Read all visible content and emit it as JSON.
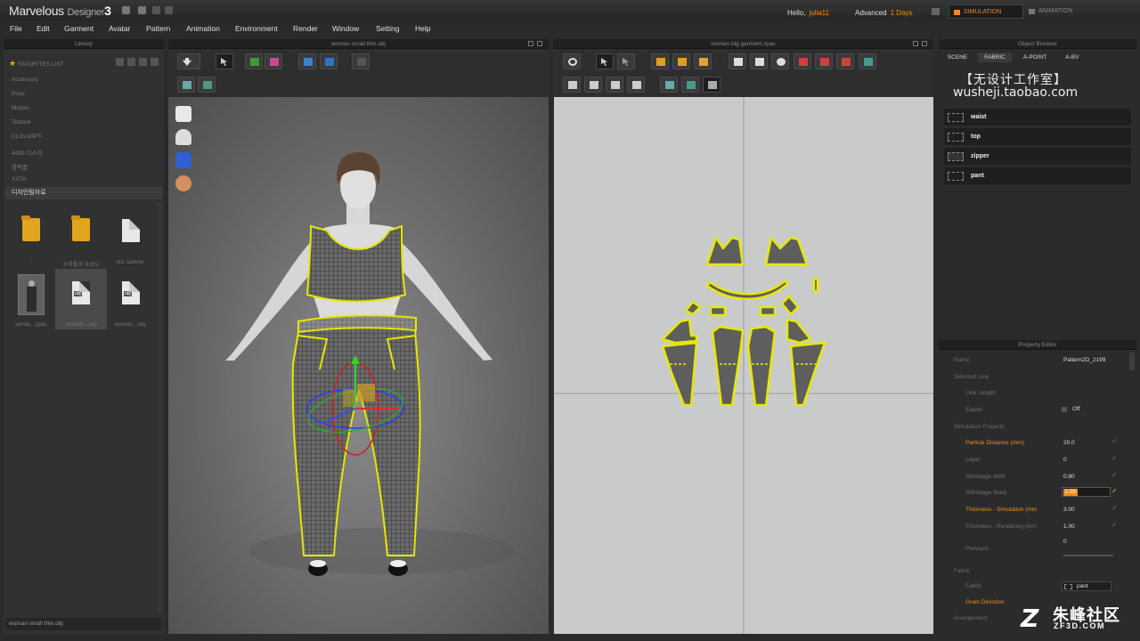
{
  "app": {
    "name": "Marvelous",
    "sub": "Designer",
    "version": "3",
    "greeting": "Hello,",
    "user": "julia11",
    "edition": "Advanced",
    "days": "1 Days",
    "modes": [
      "SIMULATION",
      "ANIMATION"
    ]
  },
  "menu": [
    "File",
    "Edit",
    "Garment",
    "Avatar",
    "Pattern",
    "Animation",
    "Environment",
    "Render",
    "Window",
    "Setting",
    "Help"
  ],
  "library": {
    "title": "Library",
    "favorites_label": "FAVORITES LIST",
    "items": [
      "Accessory",
      "Pose",
      "Motion",
      "Texture",
      "CLOvsOPTi",
      "4430-디스쳐",
      "참찍품",
      "XXTA"
    ],
    "selected": "디자인팀자료",
    "tiles": [
      {
        "type": "folder",
        "caption": ".."
      },
      {
        "type": "folder",
        "caption": "수학틀로 아셨다"
      },
      {
        "type": "doc",
        "caption": "001.camrec"
      },
      {
        "type": "thumb",
        "caption": "woma....zpac"
      },
      {
        "type": "obj",
        "caption": "woman....obj"
      },
      {
        "type": "obj",
        "caption": "woman....obj"
      }
    ],
    "obj_tag": "obj",
    "status": "woman small thin.obj"
  },
  "view3d": {
    "title": "woman small thin.obj"
  },
  "view2d": {
    "title": "woman big garment.zpac"
  },
  "object_browser": {
    "title": "Object Browser",
    "tabs": [
      "SCENE",
      "FABRIC",
      "A-POINT",
      "A-BV"
    ],
    "banner_line1": "【无设计工作室】",
    "banner_line2": "wusheji.taobao.com",
    "fabrics": [
      "waist",
      "top",
      "zipper",
      "pant"
    ]
  },
  "property_editor": {
    "title": "Property Editor",
    "rows": [
      {
        "label": "Name",
        "value": "Pattern2D_2199",
        "type": "plain"
      },
      {
        "label": "Selected Line",
        "value": "",
        "type": "section"
      },
      {
        "label": "Line Length",
        "value": "",
        "type": "plain"
      },
      {
        "label": "Elastic",
        "value": "Off",
        "type": "plain"
      },
      {
        "label": "Simulation Property",
        "value": "",
        "type": "section"
      },
      {
        "label": "Particle Distance (mm)",
        "value": "20.0",
        "type": "hl"
      },
      {
        "label": "Layer",
        "value": "0",
        "type": "plain"
      },
      {
        "label": "Shrinkage Weft",
        "value": "0.80",
        "type": "plain"
      },
      {
        "label": "Shrinkage Warp",
        "value": "",
        "type": "plain"
      },
      {
        "label": "Thickness - Simulation (mm",
        "value": "3.00",
        "type": "hl"
      },
      {
        "label": "Thickness - Rendering (mm",
        "value": "1.00",
        "type": "plain"
      },
      {
        "label": "Pressure",
        "value": "0",
        "type": "plain"
      },
      {
        "label": "Fabric",
        "value": "",
        "type": "section"
      },
      {
        "label": "Fabric",
        "value": "pant",
        "type": "plain"
      },
      {
        "label": "Grain Direction",
        "value": "",
        "type": "hl"
      },
      {
        "label": "Arrangement",
        "value": "",
        "type": "section"
      }
    ],
    "edit_value": "1.00"
  },
  "watermark": {
    "logo": "Z",
    "name": "朱峰社区",
    "url": "ZF3D.COM"
  },
  "colors": {
    "accent": "#f08a1c",
    "garment_outline": "#e6e600",
    "pattern_fill": "#5a5a5a"
  }
}
